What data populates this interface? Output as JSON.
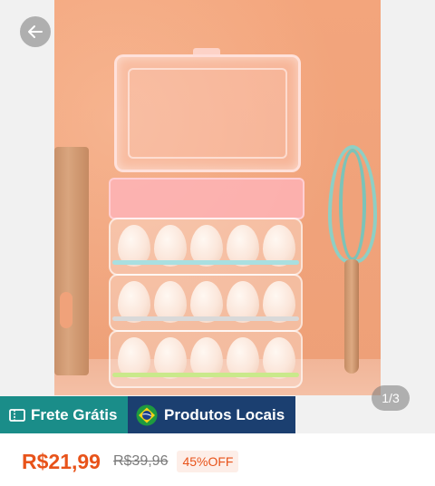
{
  "gallery": {
    "image_alt": "Plastic egg storage trays",
    "counter": "1/3"
  },
  "badges": {
    "free_shipping": "Frete Grátis",
    "local_products": "Produtos Locais"
  },
  "price": {
    "current": "R$21,99",
    "original": "R$39,96",
    "discount": "45%OFF"
  },
  "colors": {
    "price_accent": "#e8531a",
    "free_shipping_bg": "#1a8d89",
    "local_products_bg": "#1b3f70"
  },
  "icons": {
    "back": "arrow-left-icon",
    "ticket": "ticket-icon",
    "flag": "brazil-flag-icon"
  }
}
